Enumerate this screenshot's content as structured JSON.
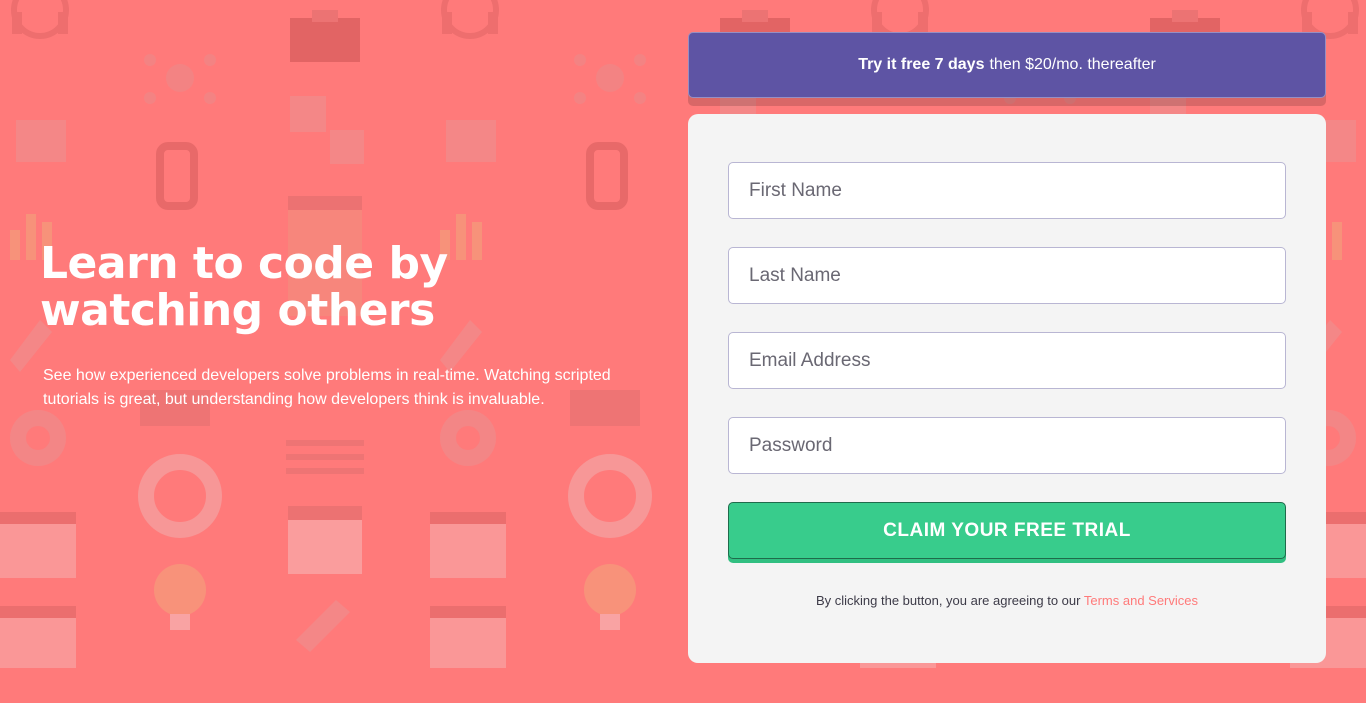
{
  "intro": {
    "title_line1": "Learn to code by",
    "title_line2": "watching others",
    "description": "See how experienced developers solve problems in real-time. Watching scripted tutorials is great, but understanding how developers think is invaluable."
  },
  "offer": {
    "bold": "Try it free 7 days",
    "rest": "then $20/mo. thereafter"
  },
  "form": {
    "first_name_placeholder": "First Name",
    "last_name_placeholder": "Last Name",
    "email_placeholder": "Email Address",
    "password_placeholder": "Password",
    "submit_label": "CLAIM YOUR FREE TRIAL",
    "terms_prefix": "By clicking the button, you are agreeing to our",
    "terms_link": "Terms and Services"
  },
  "colors": {
    "background": "#ff7a7a",
    "offer_banner": "#5e54a4",
    "cta": "#38cc8c",
    "card": "#f4f4f4"
  },
  "background_pattern_icons": [
    "headset-icon",
    "network-icon",
    "thumbs-up-icon",
    "chain-link-icon",
    "chart-icon",
    "pen-icon",
    "rocket-icon",
    "gear-icon",
    "lifebuoy-icon",
    "calendar-icon",
    "lightbulb-icon",
    "browser-window-icon"
  ]
}
